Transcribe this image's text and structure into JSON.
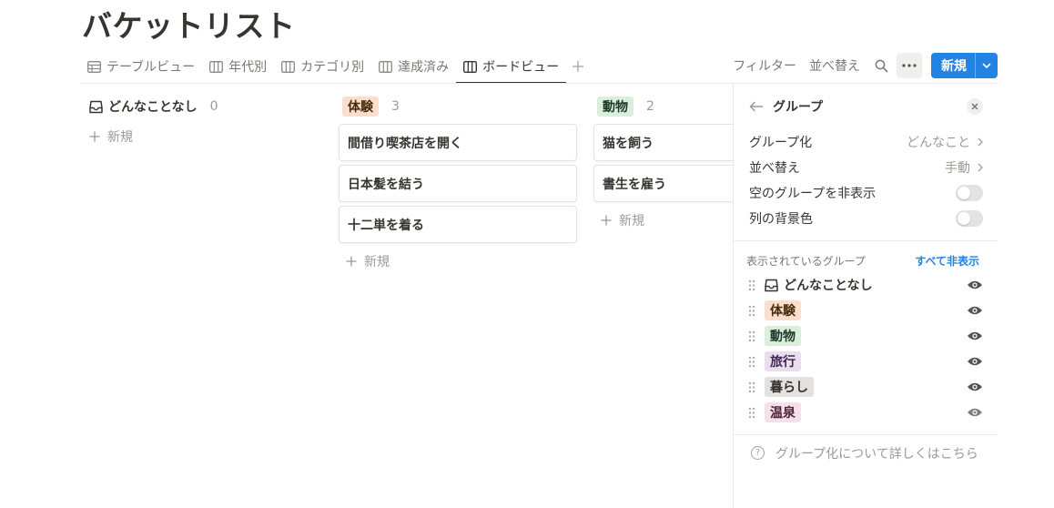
{
  "page": {
    "title": "バケットリスト"
  },
  "tabs": [
    {
      "label": "テーブルビュー",
      "icon": "table-icon"
    },
    {
      "label": "年代別",
      "icon": "board-icon"
    },
    {
      "label": "カテゴリ別",
      "icon": "board-icon"
    },
    {
      "label": "達成済み",
      "icon": "board-icon"
    },
    {
      "label": "ボードビュー",
      "icon": "board-icon",
      "active": true
    }
  ],
  "toolbar": {
    "filter_label": "フィルター",
    "sort_label": "並べ替え",
    "new_label": "新規",
    "accent_color": "#2383e2"
  },
  "board": {
    "columns": [
      {
        "name": "どんなことなし",
        "count": "0",
        "cards": [],
        "new_label": "新規"
      },
      {
        "name": "体験",
        "count": "3",
        "color": "#fbdecb",
        "text_color": "#49290e",
        "cards": [
          "間借り喫茶店を開く",
          "日本髪を結う",
          "十二単を着る"
        ],
        "new_label": "新規"
      },
      {
        "name": "動物",
        "count": "2",
        "color": "#dbeddb",
        "text_color": "#1c3829",
        "cards": [
          "猫を飼う",
          "書生を雇う"
        ],
        "new_label": "新規"
      }
    ]
  },
  "panel": {
    "title": "グループ",
    "settings": {
      "group_by_label": "グループ化",
      "group_by_value": "どんなこと",
      "sort_label": "並べ替え",
      "sort_value": "手動",
      "hide_empty_label": "空のグループを非表示",
      "hide_empty_on": false,
      "col_bg_label": "列の背景色",
      "col_bg_on": false
    },
    "visible_groups_label": "表示されているグループ",
    "hide_all_label": "すべて非表示",
    "groups": [
      {
        "name": "どんなことなし",
        "plain": true
      },
      {
        "name": "体験",
        "color": "#fbdecb",
        "text_color": "#49290e"
      },
      {
        "name": "動物",
        "color": "#dbeddb",
        "text_color": "#1c3829"
      },
      {
        "name": "旅行",
        "color": "#e8deee",
        "text_color": "#412454"
      },
      {
        "name": "暮らし",
        "color": "#e3e2e0",
        "text_color": "#32302c"
      },
      {
        "name": "温泉",
        "color": "#f5e0e9",
        "text_color": "#4c2337"
      }
    ],
    "help_label": "グループ化について詳しくはこちら"
  }
}
